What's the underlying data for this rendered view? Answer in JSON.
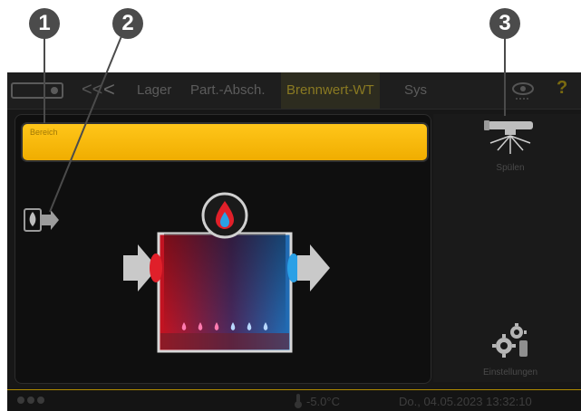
{
  "callouts": [
    "1",
    "2",
    "3"
  ],
  "nav": {
    "back": "<<",
    "arrow": "<",
    "tabs": [
      "Lager",
      "Part.-Absch.",
      "Brennwert-WT",
      "Sys"
    ],
    "active_tab": "Brennwert-WT",
    "help": "?"
  },
  "panel": {
    "title": "Bereich"
  },
  "right": {
    "rinse_label": "Spülen",
    "settings_label": "Einstellungen"
  },
  "status": {
    "temperature": "-5.0°C",
    "datetime": "Do., 04.05.2023 13:32:10"
  },
  "colors": {
    "accent": "#ffc61a",
    "hot": "#e0202a",
    "cold": "#2aa0e6"
  }
}
